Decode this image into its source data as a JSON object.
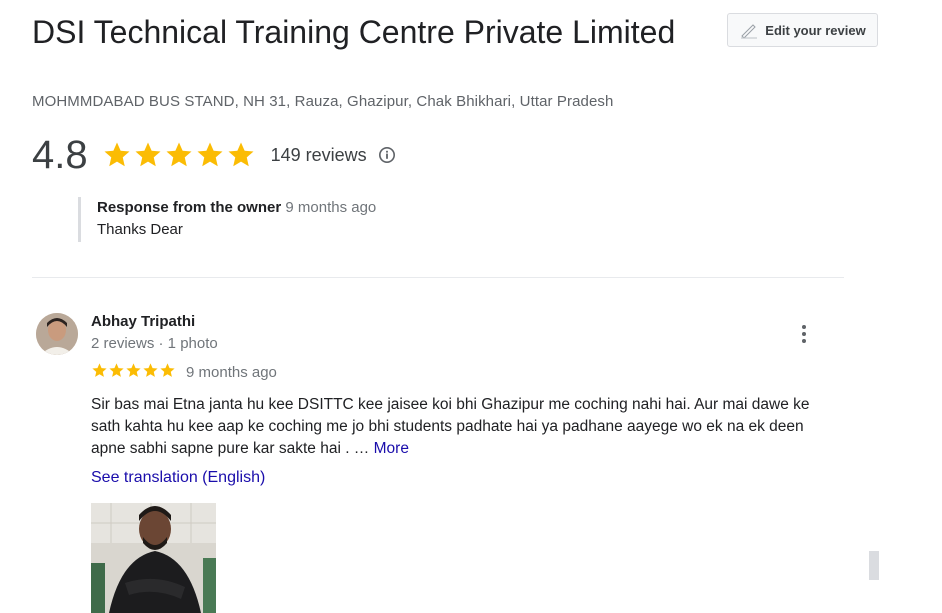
{
  "header": {
    "title": "DSI Technical Training Centre Private Limited",
    "address": "MOHMMDABAD BUS STAND, NH 31, Rauza, Ghazipur, Chak Bhikhari, Uttar Pradesh",
    "edit_review_label": "Edit your review"
  },
  "summary": {
    "rating": "4.8",
    "stars": 5,
    "reviews_count": "149 reviews",
    "star_color": "#fbbc04"
  },
  "owner_response": {
    "label": "Response from the owner",
    "time": "9 months ago",
    "text": "Thanks Dear"
  },
  "review": {
    "name": "Abhay Tripathi",
    "meta": "2 reviews · 1 photo",
    "stars": 5,
    "time": "9 months ago",
    "text": "Sir bas mai Etna janta hu kee DSITTC kee jaisee koi bhi Ghazipur me coching nahi hai. Aur mai dawe ke sath kahta hu kee aap ke coching me jo bhi students padhate hai ya padhane aayege wo ek na ek deen apne sabhi sapne pure kar sakte hai . …",
    "more_label": "More",
    "translation_label": "See translation (English)"
  },
  "icons": {
    "edit": "pencil-icon",
    "info": "info-icon",
    "menu": "more-vert-icon",
    "star": "star-icon"
  },
  "colors": {
    "link": "#1a0dab",
    "muted": "#70757a"
  }
}
